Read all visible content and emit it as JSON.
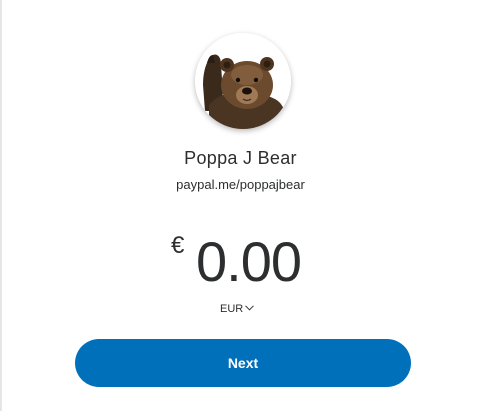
{
  "profile": {
    "avatar_icon": "bear-photo-avatar",
    "name": "Poppa J Bear",
    "link": "paypal.me/poppajbear"
  },
  "amount": {
    "currency_symbol": "€",
    "value": "0.00"
  },
  "currency": {
    "code": "EUR",
    "icon": "chevron-down-icon"
  },
  "actions": {
    "next_label": "Next"
  },
  "colors": {
    "primary_button": "#0070ba",
    "text": "#2c2e2f",
    "background": "#ffffff"
  }
}
